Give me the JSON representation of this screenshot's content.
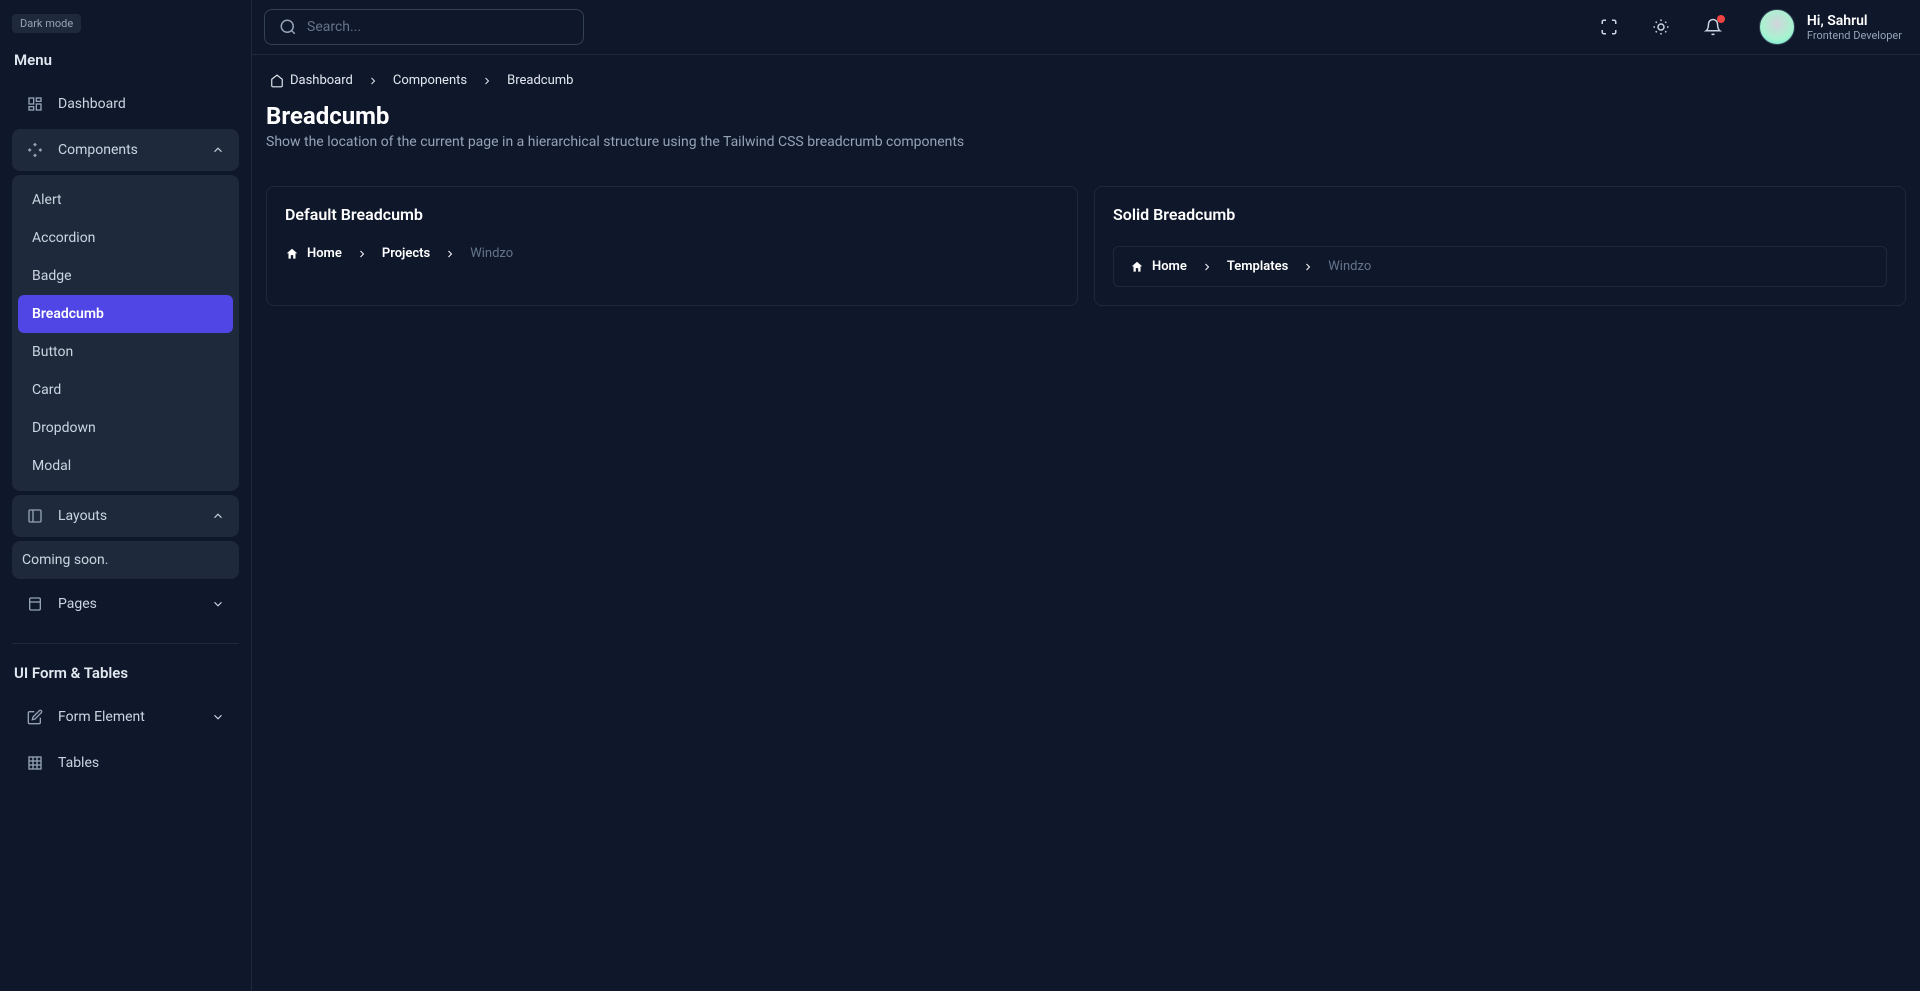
{
  "theme_badge": "Dark mode",
  "sidebar": {
    "section_menu": "Menu",
    "section_ui": "UI Form & Tables",
    "dashboard": "Dashboard",
    "components": "Components",
    "layouts": "Layouts",
    "coming_soon": "Coming soon.",
    "pages": "Pages",
    "form_element": "Form Element",
    "tables": "Tables",
    "sub_components": {
      "alert": "Alert",
      "accordion": "Accordion",
      "badge": "Badge",
      "breadcumb": "Breadcumb",
      "button": "Button",
      "card": "Card",
      "dropdown": "Dropdown",
      "modal": "Modal"
    }
  },
  "topbar": {
    "search_placeholder": "Search...",
    "user_greeting": "Hi, Sahrul",
    "user_role": "Frontend Developer"
  },
  "header_breadcrumb": {
    "dashboard": "Dashboard",
    "components": "Components",
    "breadcumb": "Breadcumb"
  },
  "page": {
    "title": "Breadcumb",
    "description": "Show the location of the current page in a hierarchical structure using the Tailwind CSS breadcrumb components"
  },
  "card_default": {
    "title": "Default Breadcumb",
    "home": "Home",
    "projects": "Projects",
    "current": "Windzo"
  },
  "card_solid": {
    "title": "Solid Breadcumb",
    "home": "Home",
    "templates": "Templates",
    "current": "Windzo"
  }
}
